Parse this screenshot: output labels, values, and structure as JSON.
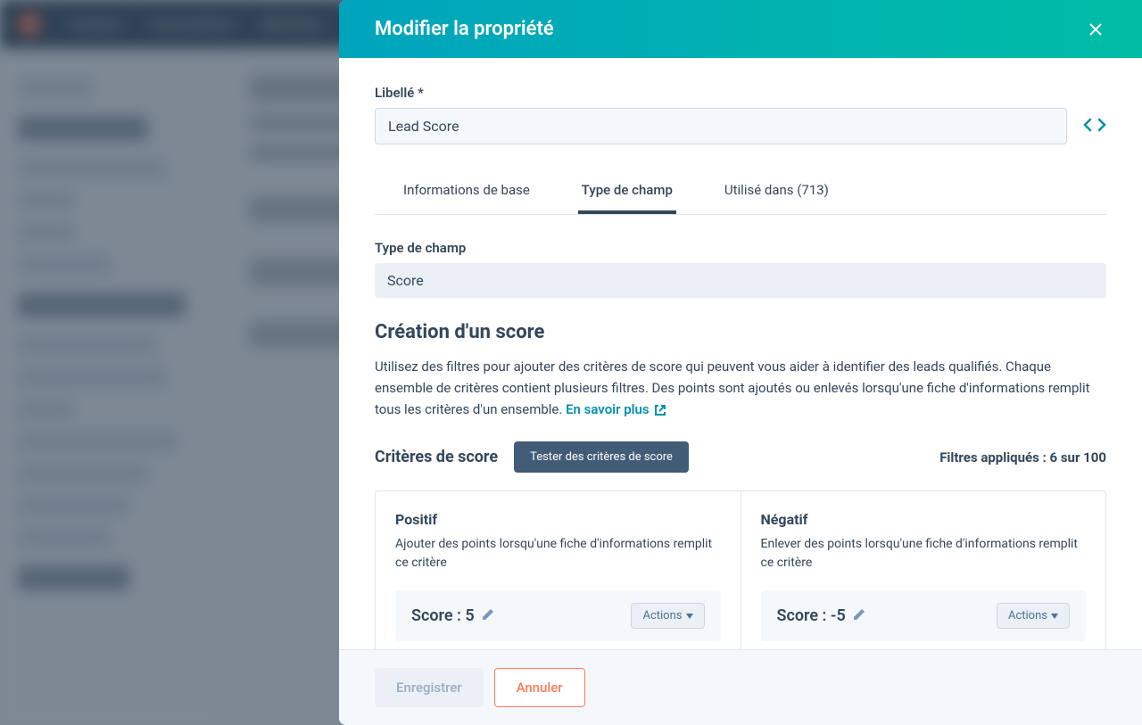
{
  "modal": {
    "title": "Modifier la propriété",
    "label_field": {
      "label": "Libellé *",
      "value": "Lead Score"
    },
    "tabs": {
      "basic": "Informations de base",
      "field_type": "Type de champ",
      "used_in": "Utilisé dans (713)"
    },
    "field_type": {
      "label": "Type de champ",
      "value": "Score"
    },
    "score_creation": {
      "title": "Création d'un score",
      "description": "Utilisez des filtres pour ajouter des critères de score qui peuvent vous aider à identifier des leads qualifiés. Chaque ensemble de critères contient plusieurs filtres. Des points sont ajoutés ou enlevés lorsqu'une fiche d'informations remplit tous les critères d'un ensemble. ",
      "learn_more": "En savoir plus"
    },
    "criteria": {
      "title": "Critères de score",
      "test_button": "Tester des critères de score",
      "filters_applied": "Filtres appliqués : 6 sur 100",
      "positive": {
        "title": "Positif",
        "description": "Ajouter des points lorsqu'une fiche d'informations remplit ce critère",
        "score": "Score : 5",
        "actions": "Actions"
      },
      "negative": {
        "title": "Négatif",
        "description": "Enlever des points lorsqu'une fiche d'informations remplit ce critère",
        "score": "Score : -5",
        "actions": "Actions"
      }
    },
    "footer": {
      "save": "Enregistrer",
      "cancel": "Annuler"
    }
  }
}
